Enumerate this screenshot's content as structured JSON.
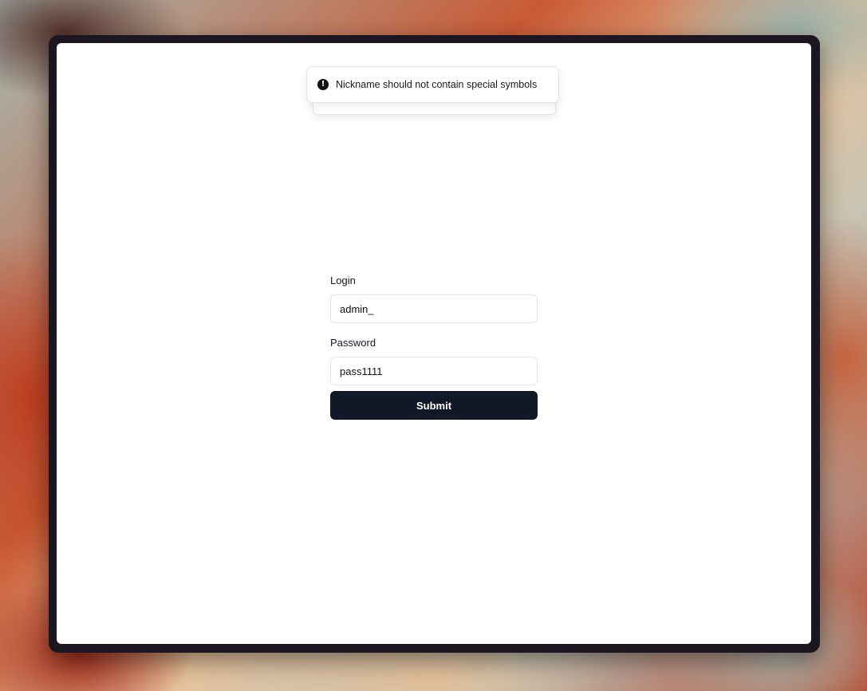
{
  "toast": {
    "icon": "exclamation-circle-icon",
    "message": "Nickname should not contain special symbols"
  },
  "form": {
    "login_label": "Login",
    "login_value": "admin_",
    "password_label": "Password",
    "password_value": "pass1111",
    "submit_label": "Submit"
  },
  "colors": {
    "button_background": "#111827",
    "window_frame": "#1c1620"
  }
}
